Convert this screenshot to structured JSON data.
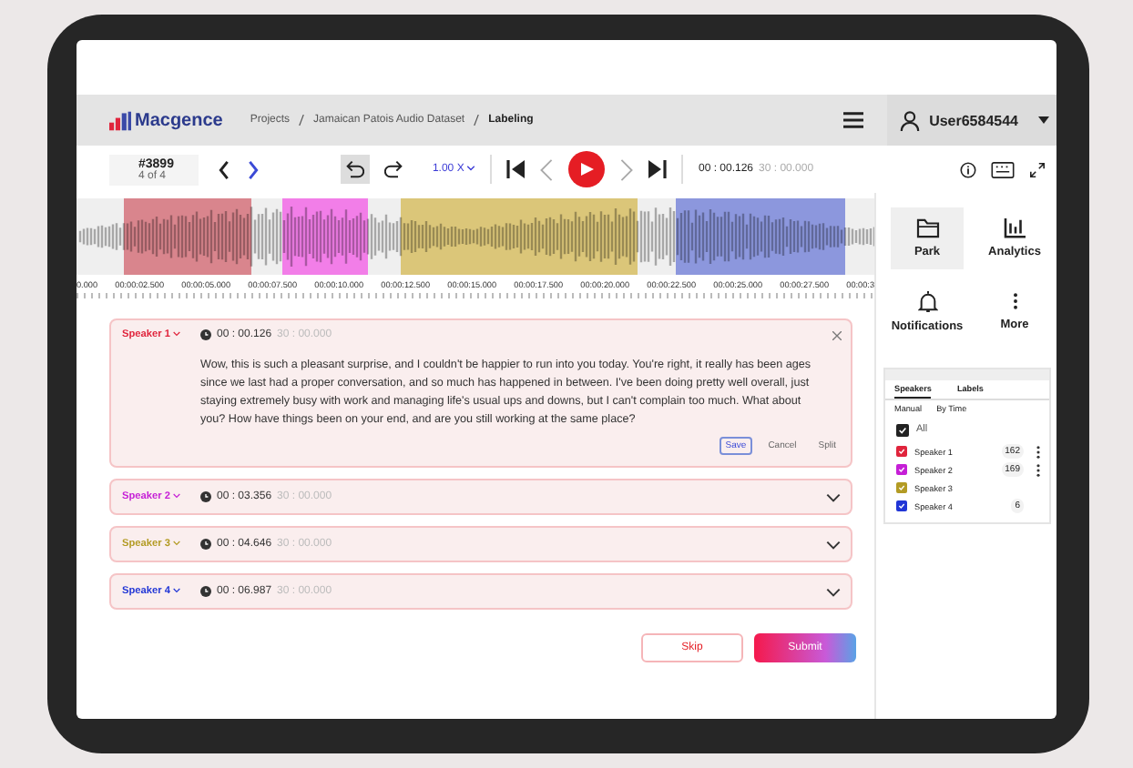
{
  "header": {
    "logo": "Macgence",
    "breadcrumb": [
      "Projects",
      "Jamaican Patois Audio Dataset",
      "Labeling"
    ],
    "user": "User6584544"
  },
  "toolbar": {
    "task_id": "#3899",
    "task_position": "4 of 4",
    "speed": "1.00 X",
    "current_time": "00 : 00.126",
    "total_time": "30 : 00.000"
  },
  "waveform": {
    "regions": [
      {
        "color": "#d9858d"
      },
      {
        "color": "#f27ee8"
      },
      {
        "color": "#dbc679"
      },
      {
        "color": "#8c97dd"
      }
    ]
  },
  "timeline": [
    "0.000",
    "00:00:02.500",
    "00:00:05.000",
    "00:00:07.500",
    "00:00:10.000",
    "00:00:12.500",
    "00:00:15.000",
    "00:00:17.500",
    "00:00:20.000",
    "00:00:22.500",
    "00:00:25.000",
    "00:00:27.500",
    "00:00:3"
  ],
  "segments": [
    {
      "speaker": "Speaker 1",
      "color": "#e0243c",
      "start": "00 : 00.126",
      "end": "30 : 00.000",
      "expanded": true,
      "text": "Wow, this is such a pleasant surprise, and I couldn't be happier to run into you today. You're right, it really has been ages since we last had a proper conversation, and so much has happened in between. I've been doing pretty well overall, just staying extremely busy with work and managing life's usual ups and downs, but I can't complain too much. What about you? How have things been on your end, and are you still working at the same place?",
      "actions": [
        {
          "label": "Save",
          "selected": true
        },
        {
          "label": "Cancel",
          "selected": false
        },
        {
          "label": "Split",
          "selected": false
        }
      ]
    },
    {
      "speaker": "Speaker 2",
      "color": "#c51fd6",
      "start": "00 : 03.356",
      "end": "30 : 00.000",
      "expanded": false
    },
    {
      "speaker": "Speaker 3",
      "color": "#b39b24",
      "start": "00 : 04.646",
      "end": "30 : 00.000",
      "expanded": false
    },
    {
      "speaker": "Speaker 4",
      "color": "#2136d6",
      "start": "00 : 06.987",
      "end": "30 : 00.000",
      "expanded": false
    }
  ],
  "side_nav": [
    {
      "label": "Park",
      "kind": "folder",
      "selected": true
    },
    {
      "label": "Analytics",
      "kind": "chart",
      "selected": false
    },
    {
      "label": "Notifications",
      "kind": "bell",
      "selected": false
    },
    {
      "label": "More",
      "kind": "more",
      "selected": false
    }
  ],
  "speaker_panel": {
    "tabs": [
      {
        "label": "Speakers",
        "selected": true
      },
      {
        "label": "Labels",
        "selected": false
      }
    ],
    "sort": [
      "Manual",
      "By Time"
    ],
    "all": {
      "label": "All",
      "checked": true
    },
    "speakers": [
      {
        "name": "Speaker 1",
        "color": "#e0243c",
        "checked": true,
        "count": "162",
        "menu": true
      },
      {
        "name": "Speaker 2",
        "color": "#c51fd6",
        "checked": true,
        "count": "169",
        "menu": true
      },
      {
        "name": "Speaker 3",
        "color": "#b39b24",
        "checked": true
      },
      {
        "name": "Speaker 4",
        "color": "#2136d6",
        "checked": true,
        "count": "6"
      }
    ]
  },
  "buttons": {
    "skip": "Skip",
    "submit": "Submit"
  }
}
